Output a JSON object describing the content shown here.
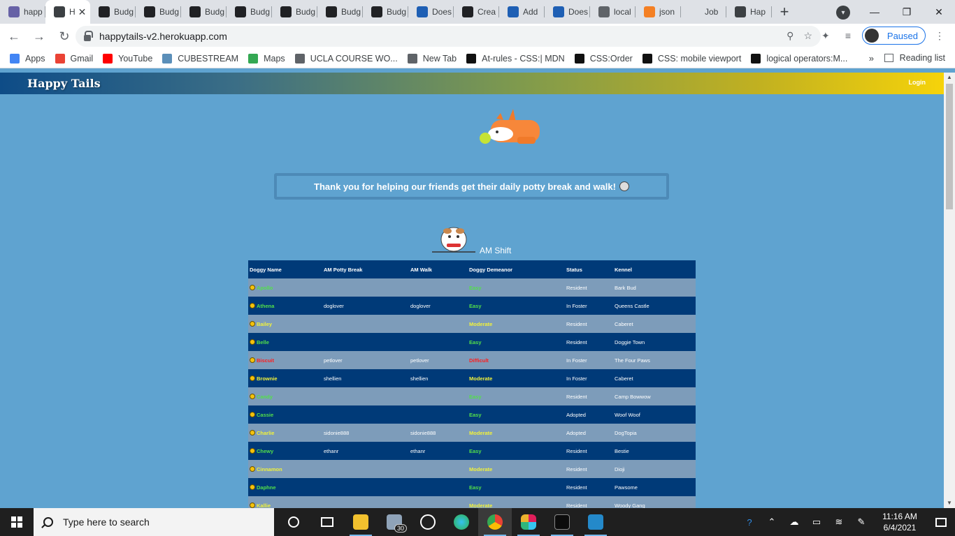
{
  "browser": {
    "tabs": [
      {
        "title": "happ",
        "icon": "heroku-icon",
        "color": "#6762a6"
      },
      {
        "title": "H",
        "icon": "paw-heart-icon",
        "color": "#3c4043",
        "active": true
      },
      {
        "title": "Budg",
        "icon": "money-bag-icon",
        "color": "#202124"
      },
      {
        "title": "Budg",
        "icon": "money-bag-icon",
        "color": "#202124"
      },
      {
        "title": "Budg",
        "icon": "money-bag-icon",
        "color": "#202124"
      },
      {
        "title": "Budg",
        "icon": "money-bag-icon",
        "color": "#202124"
      },
      {
        "title": "Budg",
        "icon": "money-bag-icon",
        "color": "#202124"
      },
      {
        "title": "Budg",
        "icon": "money-bag-icon",
        "color": "#202124"
      },
      {
        "title": "Budg",
        "icon": "money-bag-icon",
        "color": "#202124"
      },
      {
        "title": "Does",
        "icon": "terminal-icon",
        "color": "#1e5fb4"
      },
      {
        "title": "Crea",
        "icon": "codepen-icon",
        "color": "#202124"
      },
      {
        "title": "Add",
        "icon": "terminal-icon",
        "color": "#1e5fb4"
      },
      {
        "title": "Does",
        "icon": "terminal-icon",
        "color": "#1e5fb4"
      },
      {
        "title": "local",
        "icon": "globe-icon",
        "color": "#5f6368"
      },
      {
        "title": "json",
        "icon": "stackoverflow-icon",
        "color": "#f48024"
      },
      {
        "title": "Job",
        "icon": "blank-icon",
        "color": "#dee1e6"
      },
      {
        "title": "Hap",
        "icon": "paw-heart-icon",
        "color": "#3c4043"
      }
    ],
    "url": "happytails-v2.herokuapp.com",
    "profile_label": "Paused",
    "bookmarks": [
      {
        "label": "Apps",
        "color": "#4285f4"
      },
      {
        "label": "Gmail",
        "color": "#ea4335"
      },
      {
        "label": "YouTube",
        "color": "#ff0000"
      },
      {
        "label": "CUBESTREAM",
        "color": "#5b8fb9"
      },
      {
        "label": "Maps",
        "color": "#34a853"
      },
      {
        "label": "UCLA COURSE WO...",
        "color": "#5f6368"
      },
      {
        "label": "New Tab",
        "color": "#5f6368"
      },
      {
        "label": "At-rules - CSS:| MDN",
        "color": "#111111"
      },
      {
        "label": "CSS:Order",
        "color": "#111111"
      },
      {
        "label": "CSS: mobile viewport",
        "color": "#111111"
      },
      {
        "label": "logical operators:M...",
        "color": "#111111"
      }
    ],
    "bookmarks_more": "»",
    "reading_list": "Reading list"
  },
  "site": {
    "brand": "Happy Tails",
    "login": "Login",
    "banner": "Thank you for helping our friends get their daily potty break and walk!",
    "shift_title": "AM Shift",
    "colors": {
      "easy": "#53e04a",
      "moderate": "#f2f23a",
      "difficult": "#ff1e1e"
    }
  },
  "table": {
    "headers": [
      "Doggy Name",
      "AM Potty Break",
      "AM Walk",
      "Doggy Demeanor",
      "Status",
      "Kennel"
    ],
    "rows": [
      {
        "name": "Apollo",
        "potty": "",
        "walk": "",
        "demeanor": "Easy",
        "status": "Resident",
        "kennel": "Bark Bud"
      },
      {
        "name": "Athena",
        "potty": "doglover",
        "walk": "doglover",
        "demeanor": "Easy",
        "status": "In Foster",
        "kennel": "Queens Castle"
      },
      {
        "name": "Bailey",
        "potty": "",
        "walk": "",
        "demeanor": "Moderate",
        "status": "Resident",
        "kennel": "Caberet"
      },
      {
        "name": "Belle",
        "potty": "",
        "walk": "",
        "demeanor": "Easy",
        "status": "Resident",
        "kennel": "Doggie Town"
      },
      {
        "name": "Biscuit",
        "potty": "petlover",
        "walk": "petlover",
        "demeanor": "Difficult",
        "status": "In Foster",
        "kennel": "The Four Paws"
      },
      {
        "name": "Brownie",
        "potty": "shellien",
        "walk": "shellien",
        "demeanor": "Moderate",
        "status": "In Foster",
        "kennel": "Caberet"
      },
      {
        "name": "Candy",
        "potty": "",
        "walk": "",
        "demeanor": "Easy",
        "status": "Resident",
        "kennel": "Camp Bowwow"
      },
      {
        "name": "Cassie",
        "potty": "",
        "walk": "",
        "demeanor": "Easy",
        "status": "Adopted",
        "kennel": "Woof Woof"
      },
      {
        "name": "Charlie",
        "potty": "sidonie888",
        "walk": "sidonie888",
        "demeanor": "Moderate",
        "status": "Adopted",
        "kennel": "DogTopia"
      },
      {
        "name": "Chewy",
        "potty": "ethanr",
        "walk": "ethanr",
        "demeanor": "Easy",
        "status": "Resident",
        "kennel": "Bestie"
      },
      {
        "name": "Cinnamon",
        "potty": "",
        "walk": "",
        "demeanor": "Moderate",
        "status": "Resident",
        "kennel": "Dioji"
      },
      {
        "name": "Daphne",
        "potty": "",
        "walk": "",
        "demeanor": "Easy",
        "status": "Resident",
        "kennel": "Pawsome"
      },
      {
        "name": "Kallie",
        "potty": "",
        "walk": "",
        "demeanor": "Moderate",
        "status": "Resident",
        "kennel": "Woody Gang"
      }
    ]
  },
  "taskbar": {
    "search_placeholder": "Type here to search",
    "mail_badge": "30",
    "time": "11:16 AM",
    "date": "6/4/2021"
  }
}
